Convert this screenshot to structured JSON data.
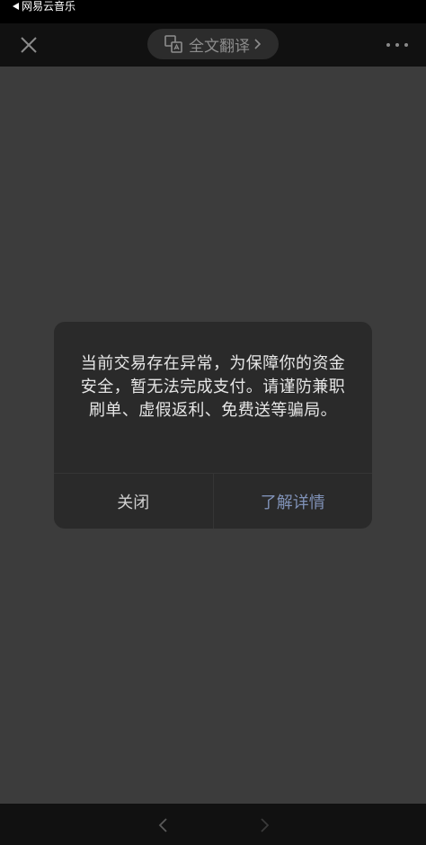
{
  "status_bar": {
    "back_app_label": "网易云音乐"
  },
  "top_bar": {
    "translate_label": "全文翻译",
    "close_icon": "close-icon",
    "more_icon": "more-dots-icon",
    "translate_icon": "translate-icon"
  },
  "dialog": {
    "message": "当前交易存在异常，为保障你的资金安全，暂无法完成支付。请谨防兼职刷单、虚假返利、免费送等骗局。",
    "close_label": "关闭",
    "detail_label": "了解详情"
  },
  "colors": {
    "detail_link": "#8092b8",
    "overlay": "#3c3c3c",
    "dialog_bg": "#2a2a2a"
  }
}
